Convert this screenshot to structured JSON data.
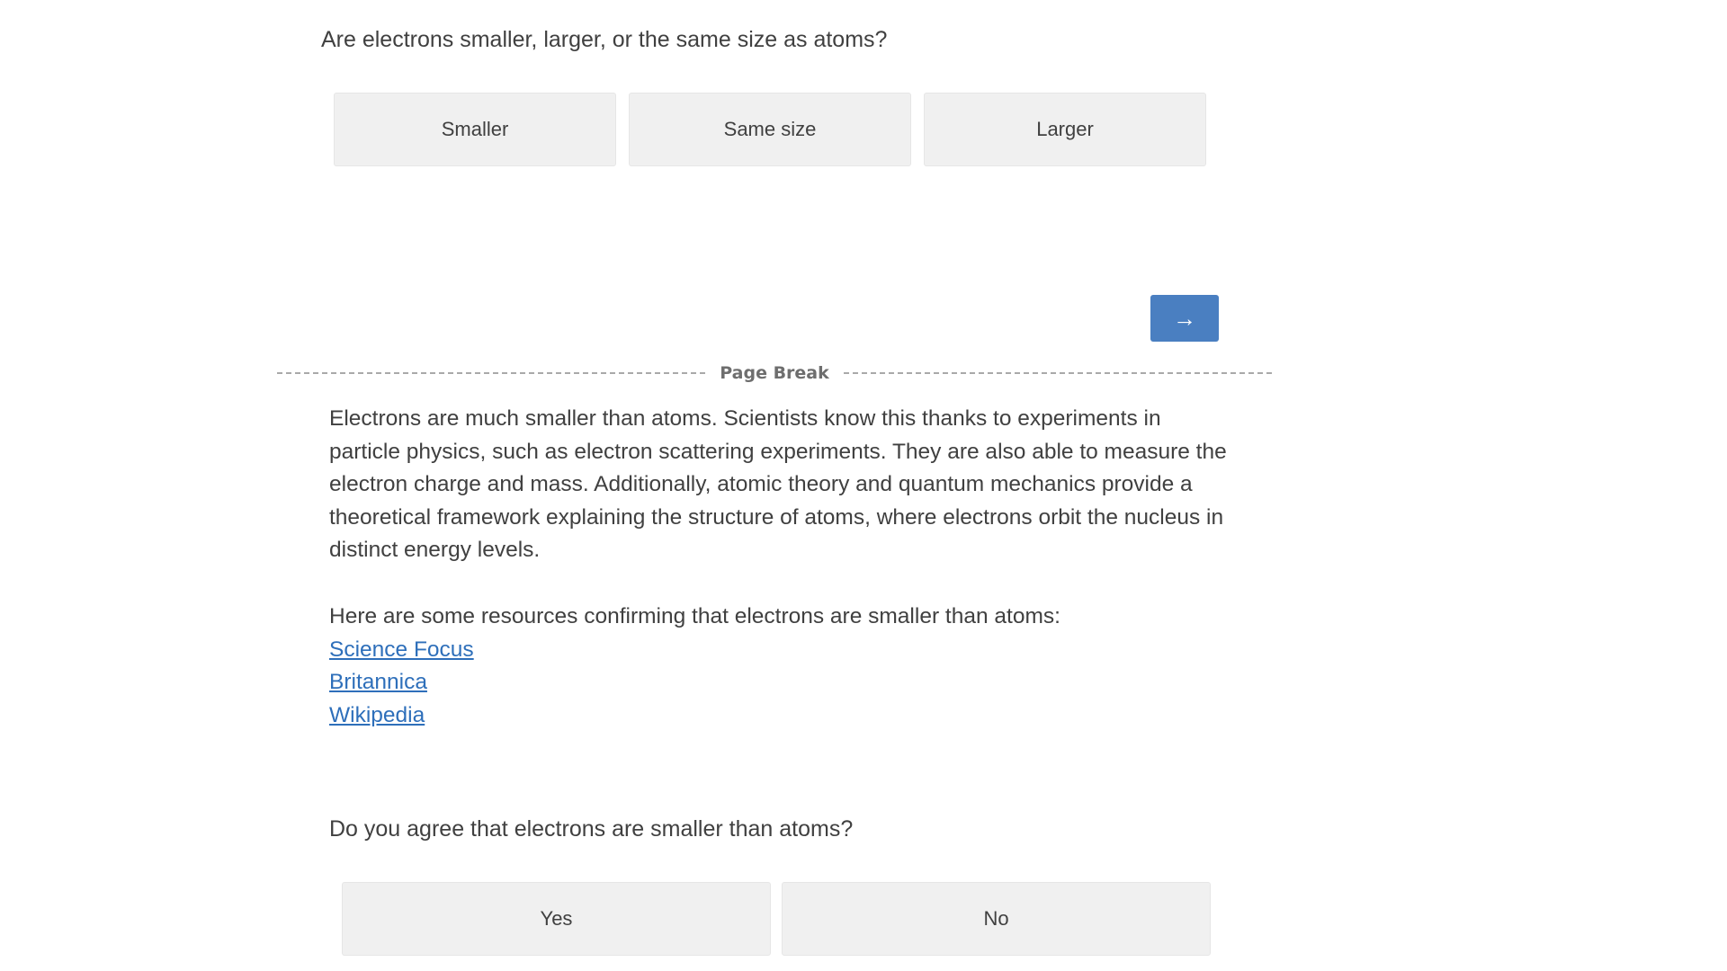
{
  "question1": {
    "text": "Are electrons smaller, larger, or the same size as atoms?",
    "choices": [
      "Smaller",
      "Same size",
      "Larger"
    ]
  },
  "navigation": {
    "next_label": "→"
  },
  "page_break": {
    "label": "Page Break"
  },
  "info": {
    "paragraph": "Electrons are much smaller than atoms. Scientists know this thanks to experiments in particle physics, such as electron scattering experiments. They are also able to measure the electron charge and mass. Additionally, atomic theory and quantum mechanics provide a theoretical framework explaining the structure of atoms, where electrons orbit the nucleus in distinct energy levels.",
    "resources_intro": "Here are some resources confirming that electrons are smaller than atoms:",
    "links": [
      "Science Focus",
      "Britannica",
      "Wikipedia"
    ]
  },
  "question2": {
    "text": "Do you agree that electrons are smaller than atoms?",
    "choices": [
      "Yes",
      "No"
    ]
  },
  "colors": {
    "next_button": "#4a7fc1",
    "link": "#2e6fba",
    "choice_bg": "#f0f0f0"
  }
}
